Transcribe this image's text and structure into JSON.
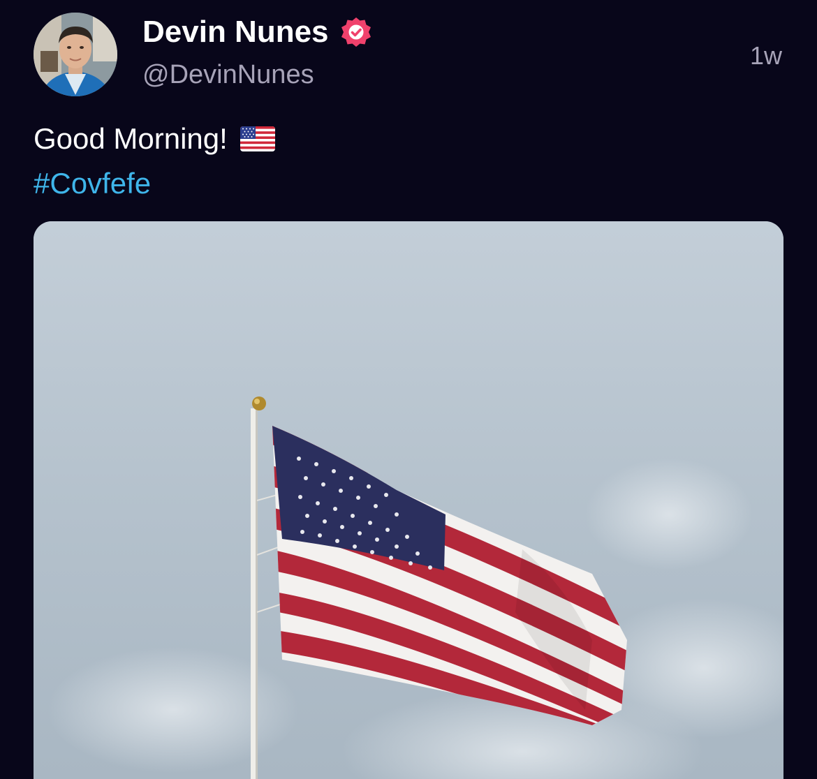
{
  "post": {
    "author": {
      "display_name": "Devin Nunes",
      "handle": "@DevinNunes",
      "verified": true,
      "verified_badge_color": "#f0416c"
    },
    "timestamp": "1w",
    "text": "Good Morning!",
    "emoji": "🇺🇸",
    "hashtag": "#Covfefe",
    "hashtag_color": "#3fb5ea",
    "media": {
      "type": "photo",
      "subject": "american-flag-on-pole"
    }
  },
  "theme": {
    "background": "#08061a",
    "primary_text": "#ffffff",
    "secondary_text": "#a7a3b8"
  }
}
